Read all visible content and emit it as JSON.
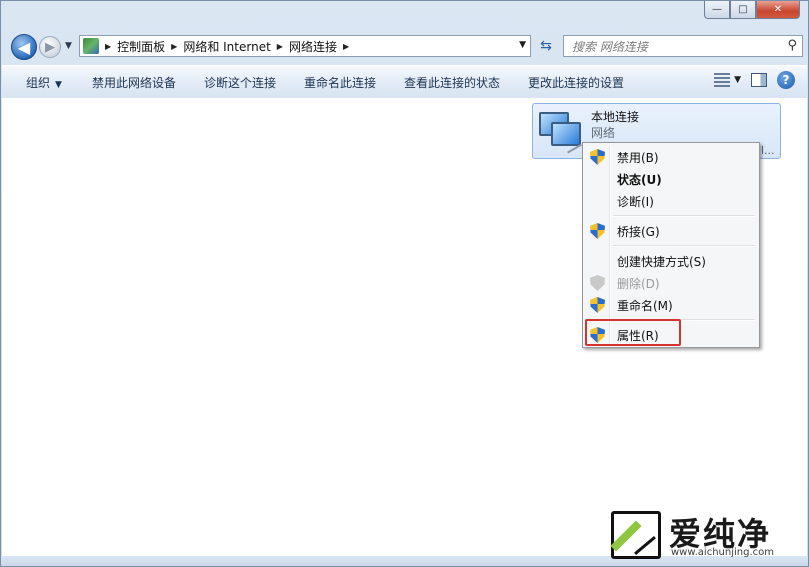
{
  "window": {
    "caption_buttons": {
      "minimize": "—",
      "maximize": "□",
      "close": "✕"
    }
  },
  "nav": {
    "breadcrumbs": [
      "控制面板",
      "网络和 Internet",
      "网络连接"
    ],
    "search_placeholder": "搜索 网络连接"
  },
  "toolbar": {
    "organize": "组织",
    "items": [
      "禁用此网络设备",
      "诊断这个连接",
      "重命名此连接",
      "查看此连接的状态",
      "更改此连接的设置"
    ],
    "help": "?"
  },
  "connection": {
    "name": "本地连接",
    "status": "网络",
    "device_truncated": "l..."
  },
  "context_menu": {
    "items": [
      {
        "label": "禁用(B)",
        "shield": true
      },
      {
        "label": "状态(U)",
        "bold": true
      },
      {
        "label": "诊断(I)"
      },
      {
        "label": "桥接(G)",
        "shield": true
      },
      {
        "label": "创建快捷方式(S)"
      },
      {
        "label": "删除(D)",
        "shield": true,
        "disabled": true
      },
      {
        "label": "重命名(M)",
        "shield": true
      },
      {
        "label": "属性(R)",
        "shield": true,
        "highlighted": true
      }
    ]
  },
  "watermark": {
    "text": "爱纯净",
    "url": "www.aichunjing.com"
  },
  "colors": {
    "highlight_border": "#d3342f",
    "watermark_accent": "#8ec63f"
  }
}
